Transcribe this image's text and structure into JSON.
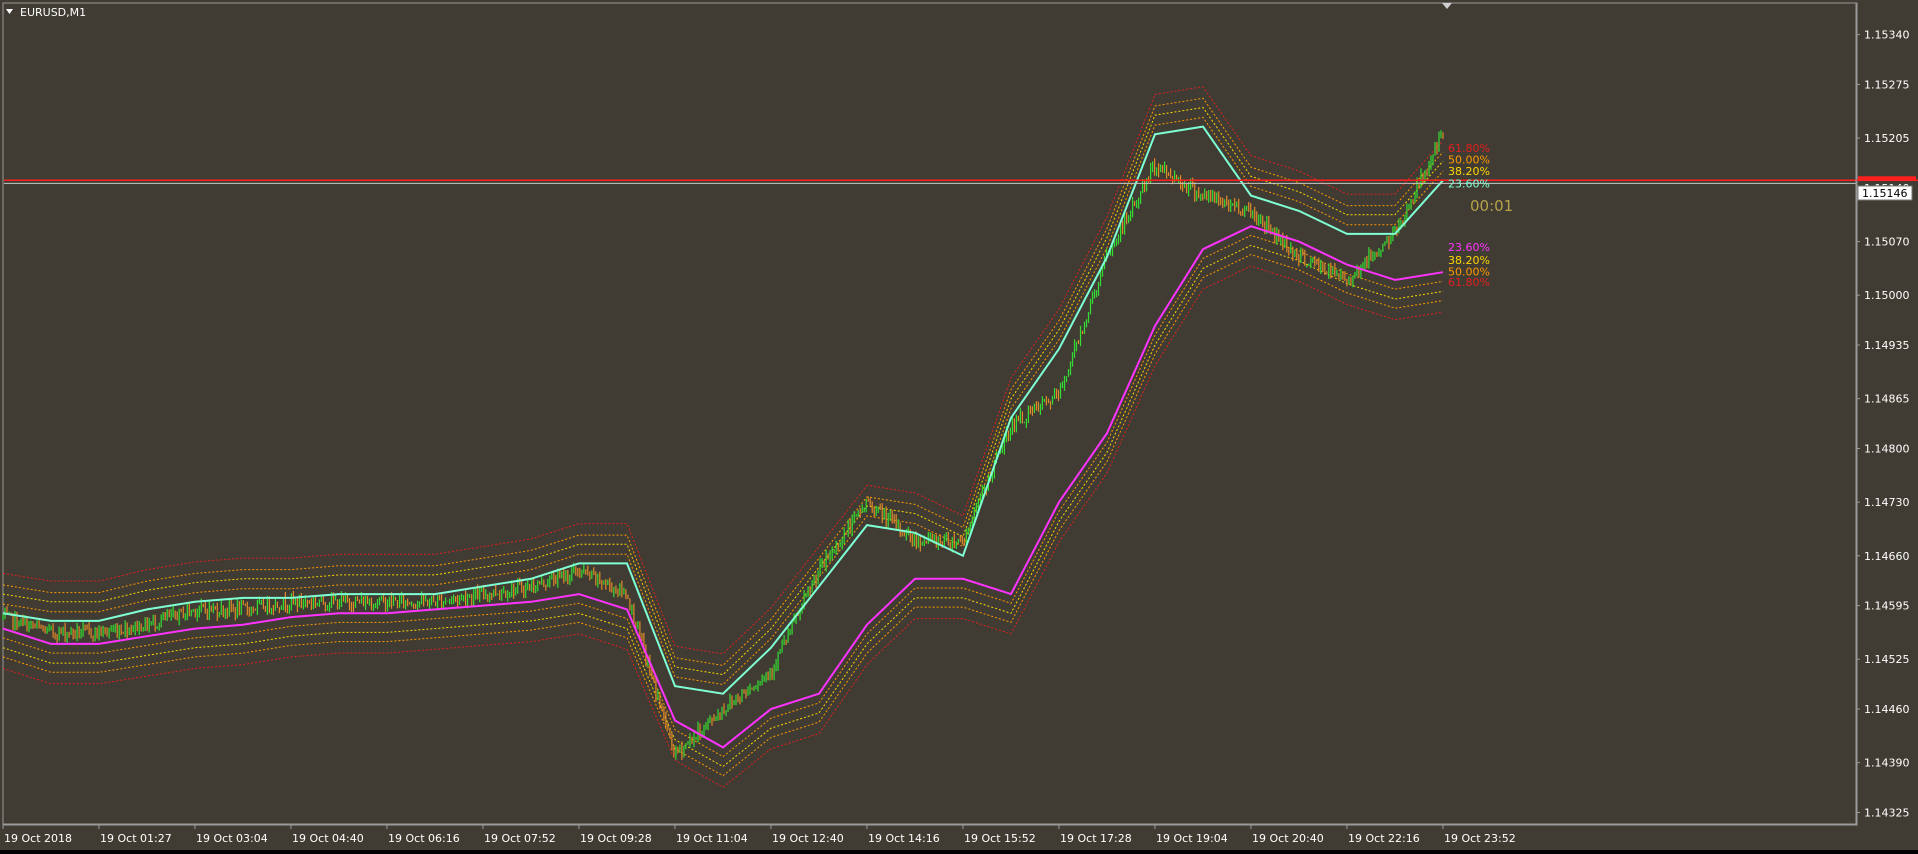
{
  "window": {
    "title": "EURUSD,M1",
    "menu_icon": "triangle-down-icon",
    "shift_marker_icon": "triangle-down-icon"
  },
  "colors": {
    "background": "#403c33",
    "frame": "#9a9a9a",
    "axis_text": "#ffffff",
    "candle_up": "#33dd33",
    "candle_down": "#e08a2a",
    "upper_midline": "#7fffd4",
    "lower_midline": "#ff33ff",
    "band_236": "#ff9900",
    "band_382": "#ffd700",
    "band_500": "#ff9900",
    "band_618": "#e02020",
    "price_line": "#ff2020",
    "bid_line": "#c8c8c8"
  },
  "chart_data": {
    "type": "line",
    "symbol": "EURUSD",
    "timeframe": "M1",
    "x_ticks": [
      "19 Oct 2018",
      "19 Oct 01:27",
      "19 Oct 03:04",
      "19 Oct 04:40",
      "19 Oct 06:16",
      "19 Oct 07:52",
      "19 Oct 09:28",
      "19 Oct 11:04",
      "19 Oct 12:40",
      "19 Oct 14:16",
      "19 Oct 15:52",
      "19 Oct 17:28",
      "19 Oct 19:04",
      "19 Oct 20:40",
      "19 Oct 22:16",
      "19 Oct 23:52"
    ],
    "y_ticks": [
      "1.15340",
      "1.15275",
      "1.15205",
      "1.15140",
      "1.15070",
      "1.15000",
      "1.14935",
      "1.14865",
      "1.14800",
      "1.14730",
      "1.14660",
      "1.14595",
      "1.14525",
      "1.14460",
      "1.14390",
      "1.14325"
    ],
    "ylim": [
      1.1431,
      1.1538
    ],
    "current_price": "1.15146",
    "current_price_value": 1.15146,
    "reference_line_value": 1.1515,
    "countdown": "00:01",
    "grid": false,
    "x": [
      0,
      0.5,
      1,
      1.5,
      2,
      2.5,
      3,
      3.5,
      4,
      4.5,
      5,
      5.5,
      6,
      6.5,
      7,
      7.5,
      8,
      8.5,
      9,
      9.5,
      10,
      10.5,
      11,
      11.5,
      12,
      12.5,
      13,
      13.5,
      14,
      14.5,
      15
    ],
    "series": [
      {
        "values": [
          1.1458,
          1.1456,
          1.1456,
          1.1457,
          1.1459,
          1.1459,
          1.146,
          1.146,
          1.146,
          1.146,
          1.1461,
          1.1462,
          1.1464,
          1.1461,
          1.144,
          1.1446,
          1.1451,
          1.1464,
          1.1473,
          1.1468,
          1.1468,
          1.1483,
          1.1487,
          1.1505,
          1.1517,
          1.1513,
          1.1511,
          1.1505,
          1.1502,
          1.1508,
          1.1521
        ]
      },
      {
        "values": [
          1.14585,
          1.14575,
          1.14575,
          1.1459,
          1.146,
          1.14605,
          1.14605,
          1.1461,
          1.1461,
          1.1461,
          1.1462,
          1.1463,
          1.1465,
          1.1465,
          1.1449,
          1.1448,
          1.1454,
          1.1462,
          1.147,
          1.1469,
          1.1466,
          1.1484,
          1.1493,
          1.1505,
          1.1521,
          1.1522,
          1.1513,
          1.1511,
          1.1508,
          1.1508,
          1.1515
        ]
      },
      {
        "values": [
          1.14565,
          1.14545,
          1.14545,
          1.14555,
          1.14565,
          1.1457,
          1.1458,
          1.14585,
          1.14585,
          1.1459,
          1.14595,
          1.146,
          1.1461,
          1.1459,
          1.14445,
          1.1441,
          1.1446,
          1.1448,
          1.1457,
          1.1463,
          1.1463,
          1.1461,
          1.1473,
          1.1482,
          1.1496,
          1.1506,
          1.1509,
          1.1507,
          1.1504,
          1.1502,
          1.1503
        ]
      }
    ],
    "fib_labels_upper": [
      {
        "text": "61.80%",
        "value": 1.15192
      },
      {
        "text": "50.00%",
        "value": 1.15177
      },
      {
        "text": "38.20%",
        "value": 1.15162
      },
      {
        "text": "23.60%",
        "value": 1.15146
      }
    ],
    "fib_labels_lower": [
      {
        "text": "23.60%",
        "value": 1.15063
      },
      {
        "text": "38.20%",
        "value": 1.15046
      },
      {
        "text": "50.00%",
        "value": 1.15031
      },
      {
        "text": "61.80%",
        "value": 1.15017
      }
    ]
  }
}
